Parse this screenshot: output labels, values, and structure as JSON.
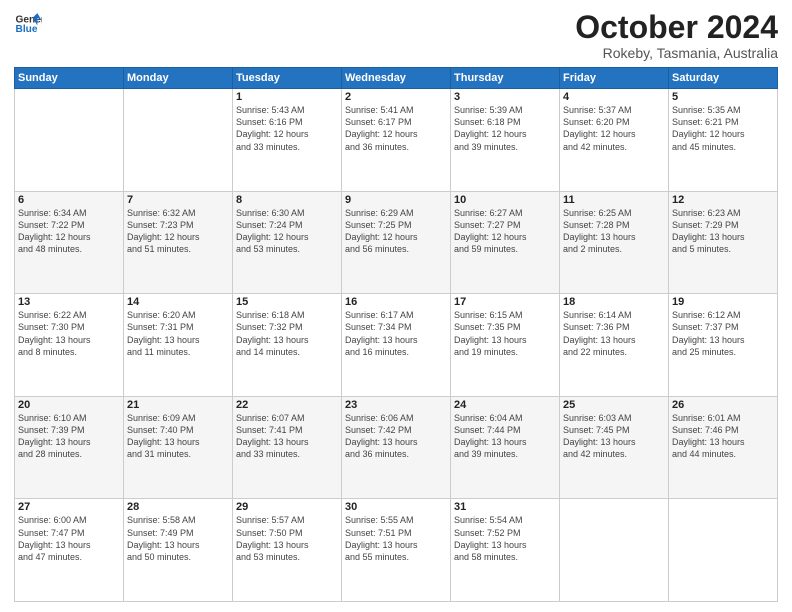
{
  "header": {
    "logo_general": "General",
    "logo_blue": "Blue",
    "month_title": "October 2024",
    "subtitle": "Rokeby, Tasmania, Australia"
  },
  "weekdays": [
    "Sunday",
    "Monday",
    "Tuesday",
    "Wednesday",
    "Thursday",
    "Friday",
    "Saturday"
  ],
  "weeks": [
    [
      {
        "day": "",
        "info": ""
      },
      {
        "day": "",
        "info": ""
      },
      {
        "day": "1",
        "info": "Sunrise: 5:43 AM\nSunset: 6:16 PM\nDaylight: 12 hours\nand 33 minutes."
      },
      {
        "day": "2",
        "info": "Sunrise: 5:41 AM\nSunset: 6:17 PM\nDaylight: 12 hours\nand 36 minutes."
      },
      {
        "day": "3",
        "info": "Sunrise: 5:39 AM\nSunset: 6:18 PM\nDaylight: 12 hours\nand 39 minutes."
      },
      {
        "day": "4",
        "info": "Sunrise: 5:37 AM\nSunset: 6:20 PM\nDaylight: 12 hours\nand 42 minutes."
      },
      {
        "day": "5",
        "info": "Sunrise: 5:35 AM\nSunset: 6:21 PM\nDaylight: 12 hours\nand 45 minutes."
      }
    ],
    [
      {
        "day": "6",
        "info": "Sunrise: 6:34 AM\nSunset: 7:22 PM\nDaylight: 12 hours\nand 48 minutes."
      },
      {
        "day": "7",
        "info": "Sunrise: 6:32 AM\nSunset: 7:23 PM\nDaylight: 12 hours\nand 51 minutes."
      },
      {
        "day": "8",
        "info": "Sunrise: 6:30 AM\nSunset: 7:24 PM\nDaylight: 12 hours\nand 53 minutes."
      },
      {
        "day": "9",
        "info": "Sunrise: 6:29 AM\nSunset: 7:25 PM\nDaylight: 12 hours\nand 56 minutes."
      },
      {
        "day": "10",
        "info": "Sunrise: 6:27 AM\nSunset: 7:27 PM\nDaylight: 12 hours\nand 59 minutes."
      },
      {
        "day": "11",
        "info": "Sunrise: 6:25 AM\nSunset: 7:28 PM\nDaylight: 13 hours\nand 2 minutes."
      },
      {
        "day": "12",
        "info": "Sunrise: 6:23 AM\nSunset: 7:29 PM\nDaylight: 13 hours\nand 5 minutes."
      }
    ],
    [
      {
        "day": "13",
        "info": "Sunrise: 6:22 AM\nSunset: 7:30 PM\nDaylight: 13 hours\nand 8 minutes."
      },
      {
        "day": "14",
        "info": "Sunrise: 6:20 AM\nSunset: 7:31 PM\nDaylight: 13 hours\nand 11 minutes."
      },
      {
        "day": "15",
        "info": "Sunrise: 6:18 AM\nSunset: 7:32 PM\nDaylight: 13 hours\nand 14 minutes."
      },
      {
        "day": "16",
        "info": "Sunrise: 6:17 AM\nSunset: 7:34 PM\nDaylight: 13 hours\nand 16 minutes."
      },
      {
        "day": "17",
        "info": "Sunrise: 6:15 AM\nSunset: 7:35 PM\nDaylight: 13 hours\nand 19 minutes."
      },
      {
        "day": "18",
        "info": "Sunrise: 6:14 AM\nSunset: 7:36 PM\nDaylight: 13 hours\nand 22 minutes."
      },
      {
        "day": "19",
        "info": "Sunrise: 6:12 AM\nSunset: 7:37 PM\nDaylight: 13 hours\nand 25 minutes."
      }
    ],
    [
      {
        "day": "20",
        "info": "Sunrise: 6:10 AM\nSunset: 7:39 PM\nDaylight: 13 hours\nand 28 minutes."
      },
      {
        "day": "21",
        "info": "Sunrise: 6:09 AM\nSunset: 7:40 PM\nDaylight: 13 hours\nand 31 minutes."
      },
      {
        "day": "22",
        "info": "Sunrise: 6:07 AM\nSunset: 7:41 PM\nDaylight: 13 hours\nand 33 minutes."
      },
      {
        "day": "23",
        "info": "Sunrise: 6:06 AM\nSunset: 7:42 PM\nDaylight: 13 hours\nand 36 minutes."
      },
      {
        "day": "24",
        "info": "Sunrise: 6:04 AM\nSunset: 7:44 PM\nDaylight: 13 hours\nand 39 minutes."
      },
      {
        "day": "25",
        "info": "Sunrise: 6:03 AM\nSunset: 7:45 PM\nDaylight: 13 hours\nand 42 minutes."
      },
      {
        "day": "26",
        "info": "Sunrise: 6:01 AM\nSunset: 7:46 PM\nDaylight: 13 hours\nand 44 minutes."
      }
    ],
    [
      {
        "day": "27",
        "info": "Sunrise: 6:00 AM\nSunset: 7:47 PM\nDaylight: 13 hours\nand 47 minutes."
      },
      {
        "day": "28",
        "info": "Sunrise: 5:58 AM\nSunset: 7:49 PM\nDaylight: 13 hours\nand 50 minutes."
      },
      {
        "day": "29",
        "info": "Sunrise: 5:57 AM\nSunset: 7:50 PM\nDaylight: 13 hours\nand 53 minutes."
      },
      {
        "day": "30",
        "info": "Sunrise: 5:55 AM\nSunset: 7:51 PM\nDaylight: 13 hours\nand 55 minutes."
      },
      {
        "day": "31",
        "info": "Sunrise: 5:54 AM\nSunset: 7:52 PM\nDaylight: 13 hours\nand 58 minutes."
      },
      {
        "day": "",
        "info": ""
      },
      {
        "day": "",
        "info": ""
      }
    ]
  ]
}
